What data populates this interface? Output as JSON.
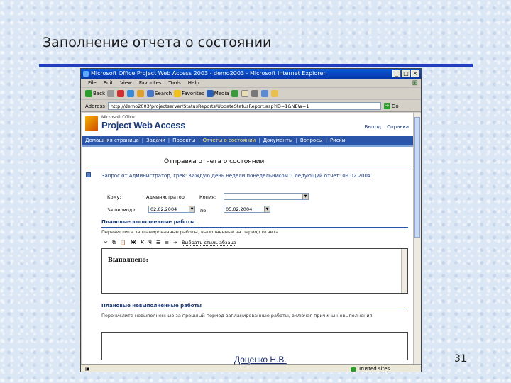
{
  "slide": {
    "title": "Заполнение отчета о состоянии",
    "author": "Доценко Н.В.",
    "page_number": "31"
  },
  "browser": {
    "window_title": "Microsoft Office Project Web Access 2003 - demo2003 - Microsoft Internet Explorer",
    "menu": [
      "File",
      "Edit",
      "View",
      "Favorites",
      "Tools",
      "Help"
    ],
    "toolbar": {
      "back_label": "Back",
      "search_label": "Search",
      "favorites_label": "Favorites",
      "media_label": "Media"
    },
    "address_label": "Address",
    "address_value": "http://demo2003/projectserver/StatusReports/UpdateStatusReport.asp?ID=1&NEW=1",
    "go_label": "Go",
    "status_zone": "Trusted sites",
    "icons": {
      "back": "back-arrow-icon",
      "forward": "forward-arrow-icon",
      "stop": "stop-icon",
      "refresh": "refresh-icon",
      "home": "home-icon",
      "search": "search-icon",
      "favorites": "star-icon",
      "media": "media-icon",
      "history": "history-icon",
      "mail": "mail-icon",
      "print": "print-icon",
      "edit": "edit-icon",
      "folder": "folder-icon"
    }
  },
  "pwa": {
    "logo_small": "Microsoft Office",
    "logo_main": "Project Web Access",
    "top_links": [
      "Выход",
      "Справка"
    ],
    "nav": [
      "Домашняя страница",
      "Задачи",
      "Проекты",
      "Отчеты о состоянии",
      "Документы",
      "Вопросы",
      "Риски"
    ],
    "nav_active_index": 3,
    "page_heading": "Отправка отчета о состоянии",
    "request_text": "Запрос от Администратор, грек: Каждую день недели понедельником. Следующий отчет: 09.02.2004.",
    "form": {
      "to_label": "Кому:",
      "to_value": "Администратор",
      "copy_label": "Копия:",
      "period_label": "За период с",
      "period_from": "02.02.2004",
      "period_to_label": "по",
      "period_to": "05.02.2004"
    },
    "section1": {
      "title": "Плановые выполненные работы",
      "desc": "Перечислите запланированные работы, выполненные за период отчета"
    },
    "editor": {
      "style_label": "Выбрать стиль абзаца",
      "content": "Выполнено:"
    },
    "section2": {
      "title": "Плановые невыполненные работы",
      "desc": "Перечислите невыполненные за прошлый период запланированные работы, включая причины невыполнения"
    }
  },
  "colors": {
    "title_rule": "#1f3fbf",
    "nav_bg": "#2a55a8",
    "titlebar": "#0a48c8"
  }
}
